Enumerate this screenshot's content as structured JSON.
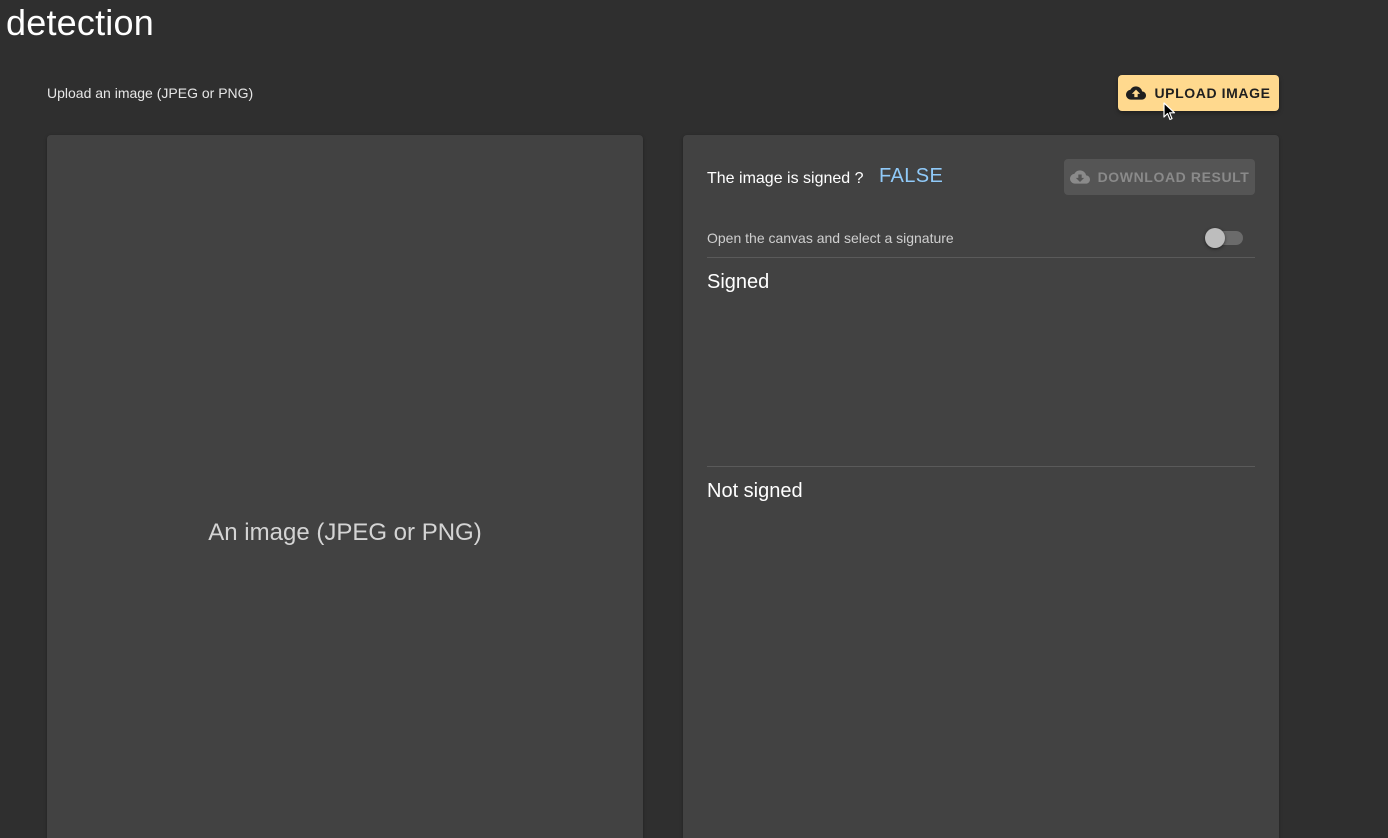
{
  "header": {
    "title": "detection"
  },
  "upload": {
    "hint": "Upload an image (JPEG or PNG)",
    "button_label": "UPLOAD IMAGE",
    "button_icon": "cloud-upload-icon",
    "button_color": "#ffd98e"
  },
  "left_panel": {
    "placeholder": "An image (JPEG or PNG)"
  },
  "right_panel": {
    "signed_question": "The image is signed ?",
    "signed_value": "FALSE",
    "signed_value_color": "#90caf9",
    "download_label": "DOWNLOAD RESULT",
    "download_icon": "cloud-download-icon",
    "download_disabled": true,
    "canvas_toggle_label": "Open the canvas and select a signature",
    "canvas_toggle_on": false,
    "signed_heading": "Signed",
    "not_signed_heading": "Not signed"
  }
}
